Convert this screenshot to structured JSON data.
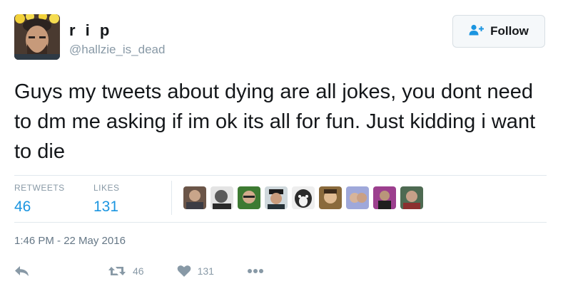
{
  "author": {
    "display_name": "r i p",
    "handle": "@hallzie_is_dead"
  },
  "follow_button": {
    "label": "Follow"
  },
  "tweet": {
    "text": "Guys my tweets about dying are all jokes, you dont need to dm me asking if im ok its all for fun. Just kidding i want to die",
    "timestamp": "1:46 PM - 22 May 2016"
  },
  "stats": {
    "retweets_label": "RETWEETS",
    "retweets_value": "46",
    "likes_label": "LIKES",
    "likes_value": "131"
  },
  "actions": {
    "retweet_count": "46",
    "like_count": "131"
  },
  "colors": {
    "link_blue": "#1b95e0",
    "muted_gray": "#8899a6",
    "text_dark": "#14171a"
  },
  "icons": [
    "reply-icon",
    "retweet-icon",
    "heart-icon",
    "more-icon",
    "follow-person-icon"
  ]
}
